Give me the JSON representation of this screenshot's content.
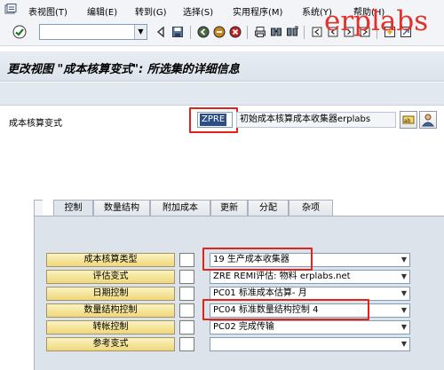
{
  "menu": {
    "items": [
      "表视图(T)",
      "编辑(E)",
      "转到(G)",
      "选择(S)",
      "实用程序(M)",
      "系统(Y)",
      "帮助(H)"
    ]
  },
  "toolbar": {
    "command_value": ""
  },
  "watermark": {
    "text": "erplabs",
    "color": "#e0322a"
  },
  "page": {
    "title": "更改视图 \"成本核算变式\": 所选集的详细信息"
  },
  "header": {
    "label": "成本核算变式",
    "key": "ZPRE",
    "description": "初始成本核算成本收集器erplabs"
  },
  "tabs": [
    "控制",
    "数量结构",
    "附加成本",
    "更新",
    "分配",
    "杂项"
  ],
  "control_rows": [
    {
      "label": "成本核算类型",
      "value": "19 生产成本收集器"
    },
    {
      "label": "评估变式",
      "value": "ZRE REMI评估: 物料 erplabs.net"
    },
    {
      "label": "日期控制",
      "value": "PC01 标准成本估算- 月"
    },
    {
      "label": "数量结构控制",
      "value": "PC04 标准数量结构控制 4"
    },
    {
      "label": "转帐控制",
      "value": "PC02 完成传输"
    },
    {
      "label": "参考变式",
      "value": ""
    }
  ],
  "colors": {
    "highlight": "#e32319",
    "label_button": "#efd77c",
    "panel": "#dce3ea"
  }
}
